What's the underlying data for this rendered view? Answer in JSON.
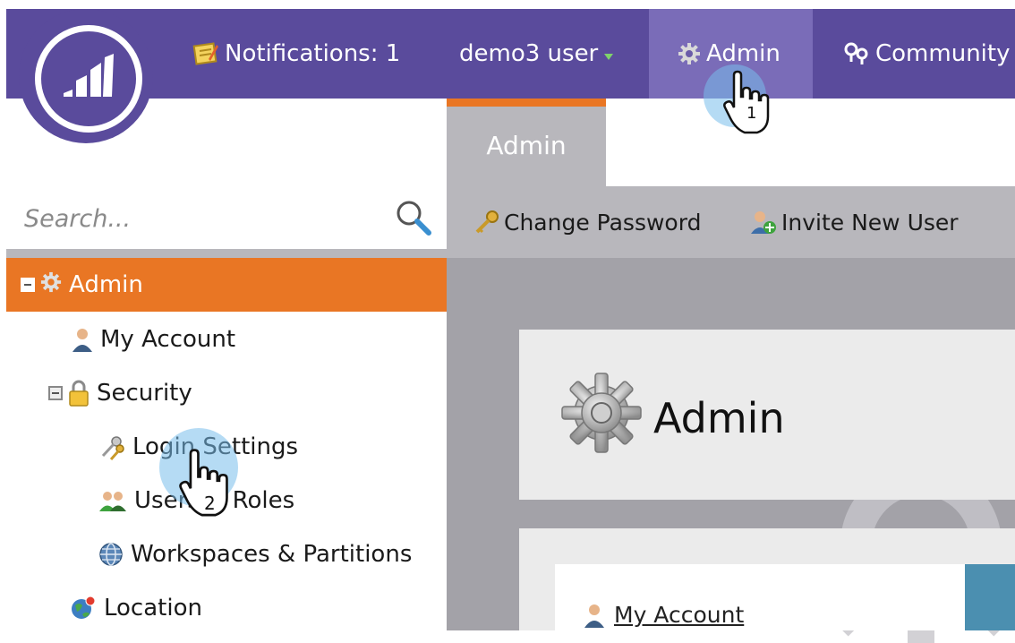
{
  "topbar": {
    "notifications_label": "Notifications: 1",
    "user_label": "demo3 user",
    "admin_label": "Admin",
    "community_label": "Community"
  },
  "tabs": {
    "admin_tab": "Admin"
  },
  "toolbar": {
    "change_password": "Change Password",
    "invite_new_user": "Invite New User"
  },
  "search": {
    "placeholder": "Search..."
  },
  "tree": {
    "root": "Admin",
    "my_account": "My Account",
    "security": "Security",
    "login_settings": "Login Settings",
    "users_roles": "Users & Roles",
    "workspaces": "Workspaces & Partitions",
    "location": "Location"
  },
  "main": {
    "panel_title": "Admin",
    "my_account_link": "My Account"
  },
  "callouts": {
    "step1": "1",
    "step2": "2"
  },
  "colors": {
    "brand_purple": "#5a4b9c",
    "active_purple": "#7a6cb8",
    "accent_orange": "#e97624",
    "panel_gray": "#b8b7bc"
  }
}
